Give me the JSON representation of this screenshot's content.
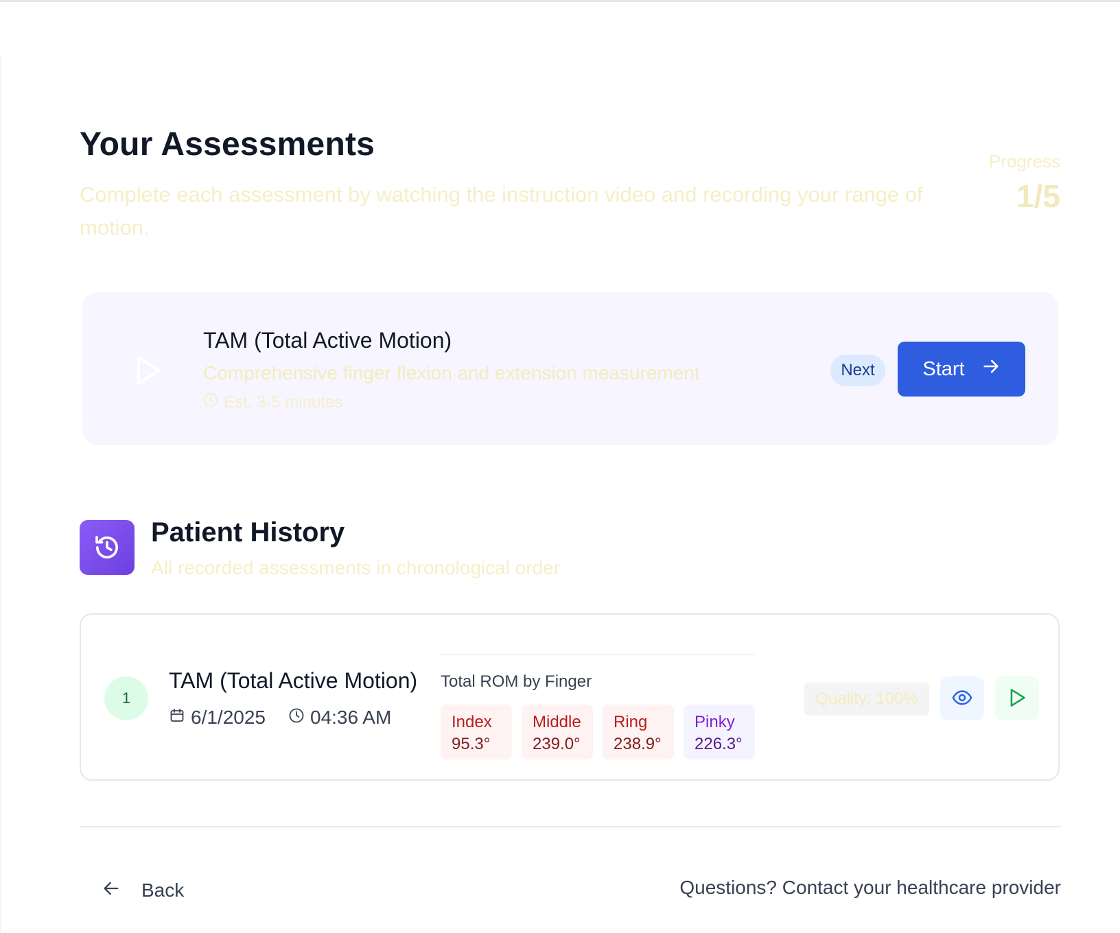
{
  "page": {
    "title": "Your Assessments",
    "subtitle": "Complete each assessment by watching the instruction video and recording your range of motion.",
    "progress_label": "Progress",
    "progress_value": "1/5"
  },
  "current_assessment": {
    "icon": "play-icon",
    "title": "TAM (Total Active Motion)",
    "description": "Comprehensive finger flexion and extension measurement",
    "estimate": "Est. 3-5 minutes",
    "badge": "Next",
    "start_label": "Start",
    "start_icon": "arrow-right-icon"
  },
  "history": {
    "icon": "history-icon",
    "title": "Patient History",
    "subtitle": "All recorded assessments in chronological order",
    "records": [
      {
        "index": "1",
        "title": "TAM (Total Active Motion)",
        "date": "6/1/2025",
        "time": "04:36 AM",
        "rom_label": "Total ROM by Finger",
        "fingers": [
          {
            "name": "Index",
            "value": "95.3°"
          },
          {
            "name": "Middle",
            "value": "239.0°"
          },
          {
            "name": "Ring",
            "value": "238.9°"
          },
          {
            "name": "Pinky",
            "value": "226.3°"
          }
        ],
        "quality": "Quality: 100%",
        "actions": [
          "eye-icon",
          "play-icon"
        ]
      }
    ]
  },
  "footer": {
    "back_label": "Back",
    "contact_text": "Questions? Contact your healthcare provider"
  },
  "colors": {
    "primary": "#2f5de0",
    "history_gradient_start": "#8b5cf6",
    "history_gradient_end": "#6d3fe0",
    "card_background": "#f7f5ff"
  }
}
